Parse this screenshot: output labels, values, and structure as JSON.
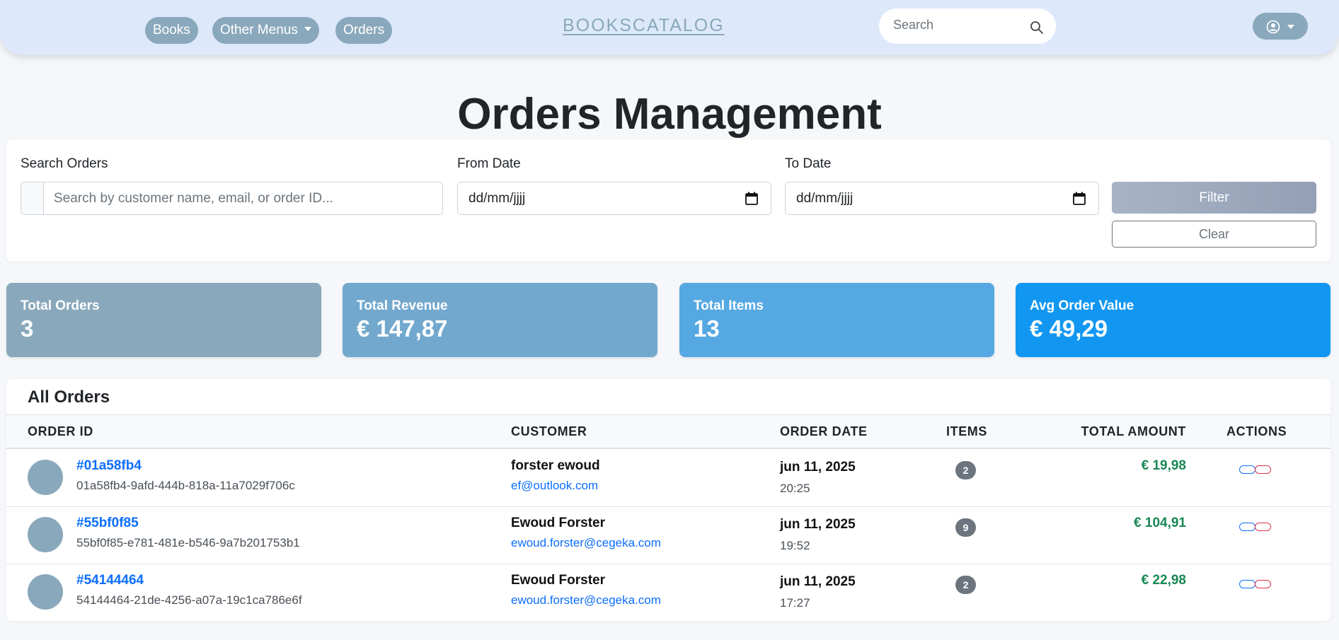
{
  "navbar": {
    "menu_books": "Books",
    "menu_other": "Other Menus",
    "menu_orders": "Orders",
    "brand": "BOOKSCATALOG",
    "search_placeholder": "Search"
  },
  "page": {
    "title": "Orders Management"
  },
  "filters": {
    "search_label": "Search Orders",
    "search_placeholder": "Search by customer name, email, or order ID...",
    "from_label": "From Date",
    "from_value": "dd/mm/jjjj",
    "to_label": "To Date",
    "to_value": "dd/mm/jjjj",
    "filter_button": "Filter",
    "clear_button": "Clear"
  },
  "stats": [
    {
      "label": "Total Orders",
      "value": "3",
      "color": "#8aa8bb"
    },
    {
      "label": "Total Revenue",
      "value": "€ 147,87",
      "color": "#72a8cd"
    },
    {
      "label": "Total Items",
      "value": "13",
      "color": "#56a8e2"
    },
    {
      "label": "Avg Order Value",
      "value": "€ 49,29",
      "color": "#1197f1"
    }
  ],
  "orders": {
    "title": "All Orders",
    "columns": [
      "Order ID",
      "Customer",
      "Order Date",
      "Items",
      "Total Amount",
      "Actions"
    ],
    "rows": [
      {
        "short_id": "#01a58fb4",
        "full_id": "01a58fb4-9afd-444b-818a-11a7029f706c",
        "customer": "forster ewoud",
        "email": "ef@outlook.com",
        "date": "jun 11, 2025",
        "time": "20:25",
        "items": "2",
        "amount": "€ 19,98"
      },
      {
        "short_id": "#55bf0f85",
        "full_id": "55bf0f85-e781-481e-b546-9a7b201753b1",
        "customer": "Ewoud Forster",
        "email": "ewoud.forster@cegeka.com",
        "date": "jun 11, 2025",
        "time": "19:52",
        "items": "9",
        "amount": "€ 104,91"
      },
      {
        "short_id": "#54144464",
        "full_id": "54144464-21de-4256-a07a-19c1ca786e6f",
        "customer": "Ewoud Forster",
        "email": "ewoud.forster@cegeka.com",
        "date": "jun 11, 2025",
        "time": "17:27",
        "items": "2",
        "amount": "€ 22,98"
      }
    ]
  },
  "icons": {
    "nav_search": "search-icon",
    "user": "user-circle-icon",
    "calendar": "calendar-icon",
    "row_view": "view-icon",
    "row_delete": "delete-icon"
  }
}
